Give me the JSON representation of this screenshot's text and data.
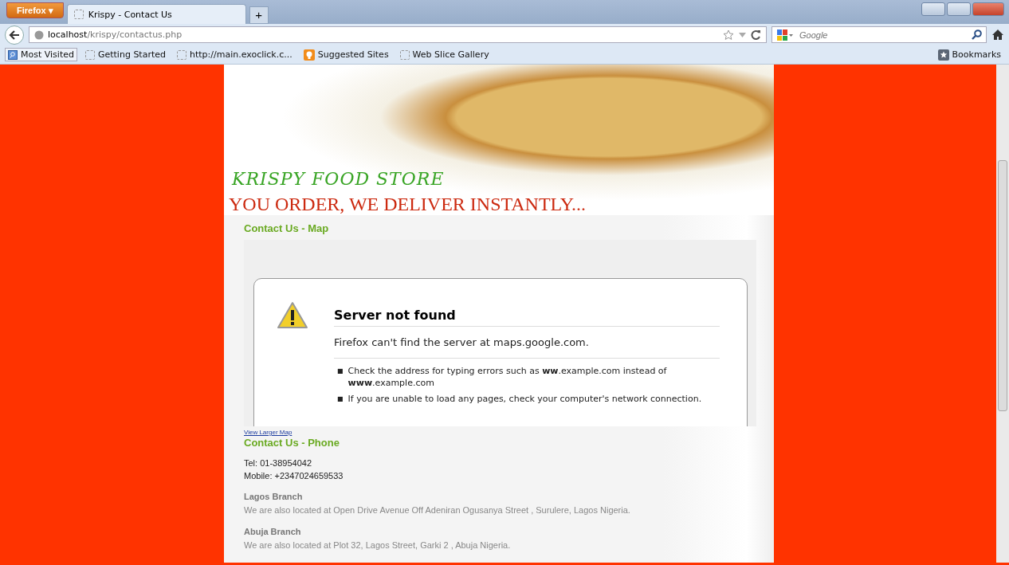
{
  "browser": {
    "menu_button": "Firefox ▾",
    "tabs": [
      {
        "label": "Krispy - Contact Us",
        "selected": true
      }
    ],
    "new_tab": "+",
    "address": {
      "host": "localhost",
      "path": "/krispy/contactus.php"
    },
    "search": {
      "placeholder": "Google"
    },
    "bookmarks_bar": [
      {
        "label": "Most Visited",
        "kind": "folder"
      },
      {
        "label": "Getting Started",
        "kind": "page"
      },
      {
        "label": "http://main.exoclick.c...",
        "kind": "page"
      },
      {
        "label": "Suggested Sites",
        "kind": "suggested"
      },
      {
        "label": "Web Slice Gallery",
        "kind": "page"
      }
    ],
    "bookmarks_menu": "Bookmarks"
  },
  "banner": {
    "title": "KRISPY FOOD STORE",
    "tagline": "YOU ORDER, WE DELIVER INSTANTLY..."
  },
  "map_section": {
    "heading": "Contact Us - Map",
    "error": {
      "title": "Server not found",
      "message": "Firefox can't find the server at maps.google.com.",
      "tips": [
        {
          "marker": "■",
          "text": "Check the address for typing errors such as **ww**.example.com instead of **www**.example.com"
        },
        {
          "marker": "■",
          "text": "If you are unable to load any pages, check your computer's network connection."
        }
      ]
    },
    "link": "View Larger Map"
  },
  "phone_section": {
    "heading": "Contact Us - Phone",
    "lines": [
      "Tel: 01-38954042",
      "Mobile: +2347024659533"
    ],
    "branches": [
      {
        "name": "Lagos Branch",
        "address": "We are also located at Open Drive Avenue Off Adeniran Ogusanya Street , Surulere, Lagos Nigeria."
      },
      {
        "name": "Abuja Branch",
        "address": "We are also located at Plot 32, Lagos Street, Garki 2 , Abuja Nigeria."
      }
    ]
  }
}
